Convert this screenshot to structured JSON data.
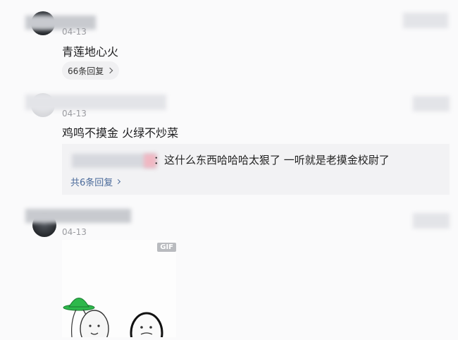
{
  "comments": [
    {
      "date": "04-13",
      "text": "青莲地心火",
      "replies_label": "66条回复"
    },
    {
      "date": "04-13",
      "text": "鸡鸣不摸金 火绿不炒菜",
      "reply_text": "：这什么东西哈哈哈太狠了 一听就是老摸金校尉了",
      "more_replies_label": "共6条回复"
    },
    {
      "date": "04-13",
      "gif_badge": "GIF"
    }
  ],
  "icons": {
    "chevron": "chevron-right-icon",
    "helmet_color": "#2db84b"
  }
}
